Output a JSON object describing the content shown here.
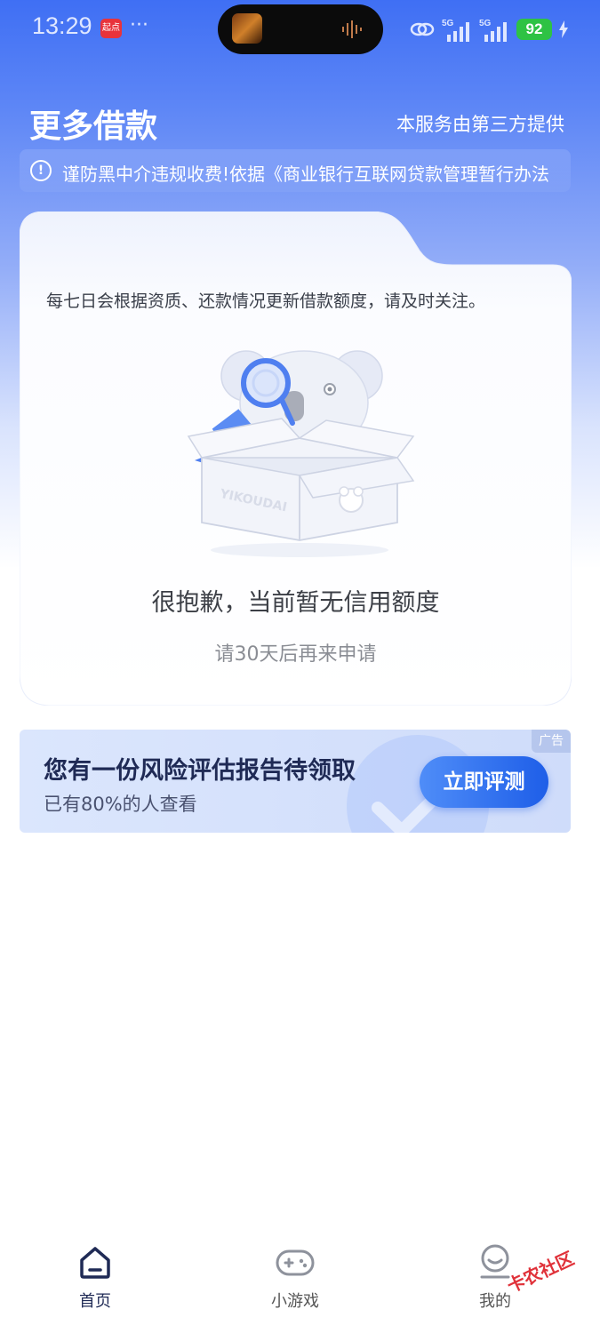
{
  "status_bar": {
    "time": "13:29",
    "app_badge": "起点",
    "more": "···",
    "signal1_label": "5G",
    "signal2_label": "5G",
    "battery": "92"
  },
  "header": {
    "title": "更多借款",
    "provider": "本服务由第三方提供"
  },
  "notice": {
    "text": "谨防黑中介违规收费!依据《商业银行互联网贷款管理暂行办法"
  },
  "card": {
    "description": "每七日会根据资质、还款情况更新借款额度，请及时关注。",
    "empty_title": "很抱歉，当前暂无信用额度",
    "empty_subtitle": "请30天后再来申请",
    "illustration_bubble": "空",
    "illustration_box_text": "YIKOUDAI"
  },
  "ad": {
    "title": "您有一份风险评估报告待领取",
    "subtitle": "已有80%的人查看",
    "button": "立即评测",
    "tag": "广告"
  },
  "tabbar": {
    "items": [
      {
        "label": "首页",
        "icon": "home-icon",
        "active": true
      },
      {
        "label": "小游戏",
        "icon": "gamepad-icon",
        "active": false
      },
      {
        "label": "我的",
        "icon": "profile-icon",
        "active": false
      }
    ]
  },
  "watermark": "卡农社区",
  "colors": {
    "header_gradient_top": "#3f6ff4",
    "accent": "#1e5ee8",
    "battery": "#2ec244"
  }
}
